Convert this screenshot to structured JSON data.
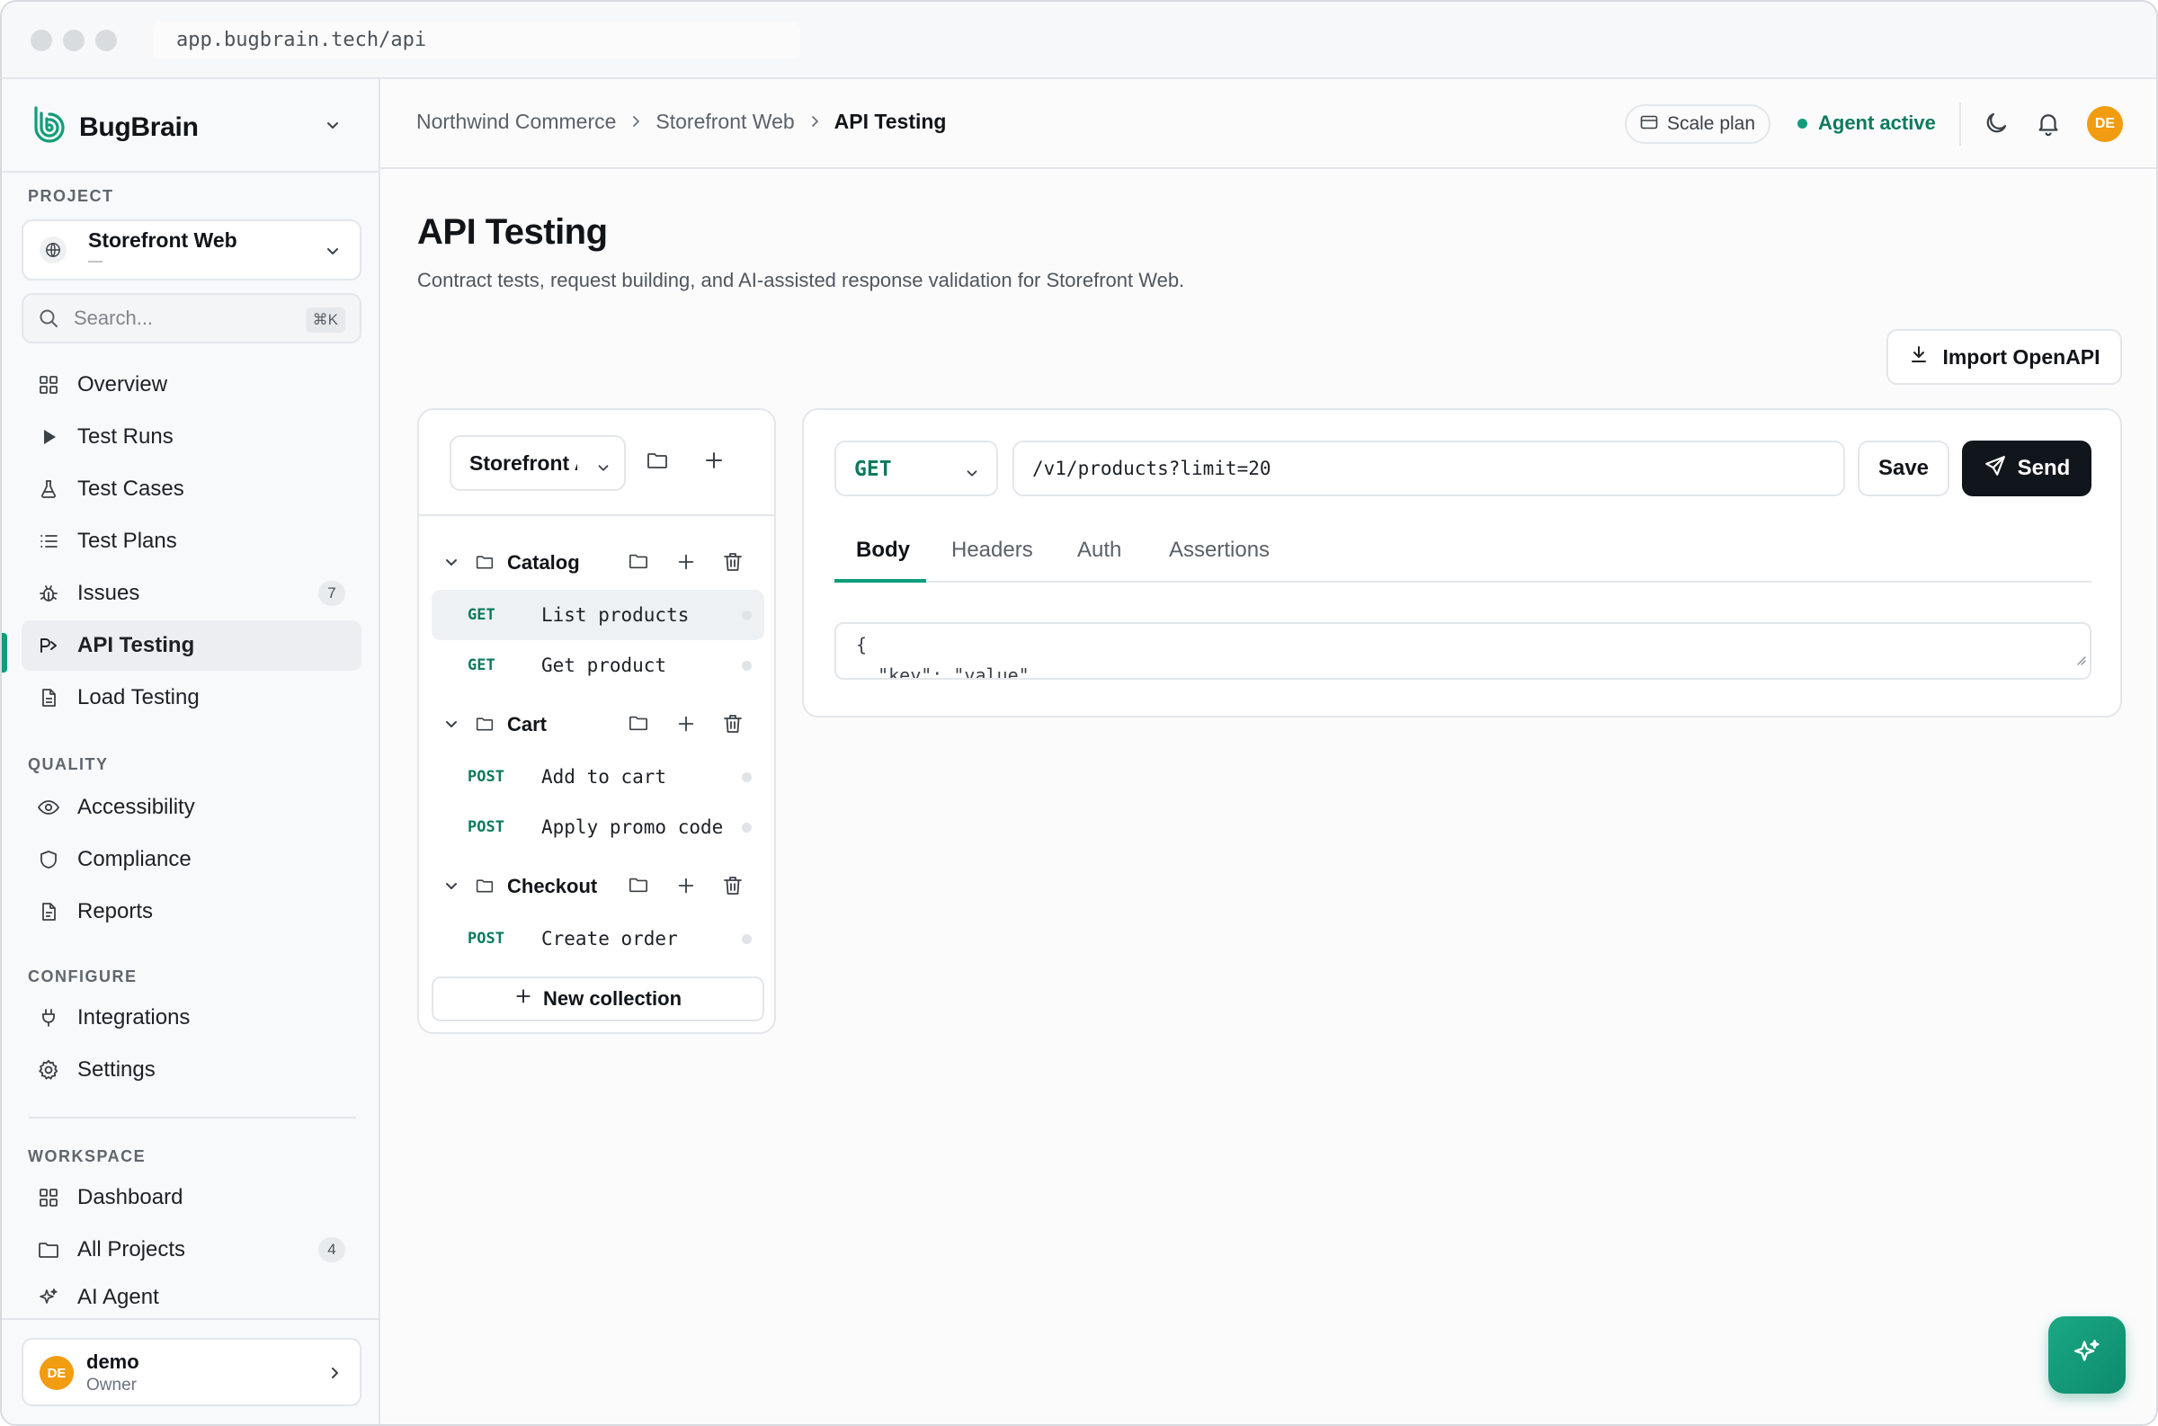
{
  "browser": {
    "url": "app.bugbrain.tech/api"
  },
  "brand": {
    "name": "BugBrain",
    "accent": "#0f9d7a"
  },
  "sidebar": {
    "project_label": "PROJECT",
    "project": {
      "name": "Storefront Web",
      "sub": "—"
    },
    "search": {
      "placeholder": "Search...",
      "shortcut": "⌘K"
    },
    "nav": [
      {
        "label": "Overview",
        "icon": "grid-icon"
      },
      {
        "label": "Test Runs",
        "icon": "play-icon"
      },
      {
        "label": "Test Cases",
        "icon": "flask-icon"
      },
      {
        "label": "Test Plans",
        "icon": "list-icon"
      },
      {
        "label": "Issues",
        "icon": "bug-icon",
        "badge": "7"
      },
      {
        "label": "API Testing",
        "icon": "api-icon",
        "active": true
      },
      {
        "label": "Load Testing",
        "icon": "file-icon"
      }
    ],
    "quality_label": "QUALITY",
    "quality": [
      {
        "label": "Accessibility",
        "icon": "eye-icon"
      },
      {
        "label": "Compliance",
        "icon": "shield-icon"
      },
      {
        "label": "Reports",
        "icon": "report-icon"
      }
    ],
    "configure_label": "CONFIGURE",
    "configure": [
      {
        "label": "Integrations",
        "icon": "plug-icon"
      },
      {
        "label": "Settings",
        "icon": "gear-icon"
      }
    ],
    "workspace_label": "WORKSPACE",
    "workspace": [
      {
        "label": "Dashboard",
        "icon": "grid-icon"
      },
      {
        "label": "All Projects",
        "icon": "folder-icon",
        "badge": "4"
      },
      {
        "label": "AI Agent",
        "icon": "sparkle-icon"
      }
    ],
    "user": {
      "initials": "DE",
      "name": "demo",
      "role": "Owner"
    }
  },
  "header": {
    "breadcrumb": [
      "Northwind Commerce",
      "Storefront Web",
      "API Testing"
    ],
    "plan": "Scale plan",
    "agent_status": "Agent active",
    "avatar_initials": "DE"
  },
  "page": {
    "title": "API Testing",
    "subtitle": "Contract tests, request building, and AI-assisted response validation for Storefront Web.",
    "import_label": "Import OpenAPI"
  },
  "collections": {
    "selected": "Storefront API",
    "folders": [
      {
        "name": "Catalog",
        "requests": [
          {
            "method": "GET",
            "name": "List products",
            "selected": true
          },
          {
            "method": "GET",
            "name": "Get product"
          }
        ]
      },
      {
        "name": "Cart",
        "requests": [
          {
            "method": "POST",
            "name": "Add to cart"
          },
          {
            "method": "POST",
            "name": "Apply promo code"
          }
        ]
      },
      {
        "name": "Checkout",
        "requests": [
          {
            "method": "POST",
            "name": "Create order"
          }
        ]
      }
    ],
    "new_label": "New collection"
  },
  "request": {
    "method": "GET",
    "url": "/v1/products?limit=20",
    "save_label": "Save",
    "send_label": "Send",
    "tabs": [
      "Body",
      "Headers",
      "Auth",
      "Assertions"
    ],
    "active_tab": "Body",
    "body_lines": [
      "{",
      "  \"key\": \"value\""
    ]
  }
}
